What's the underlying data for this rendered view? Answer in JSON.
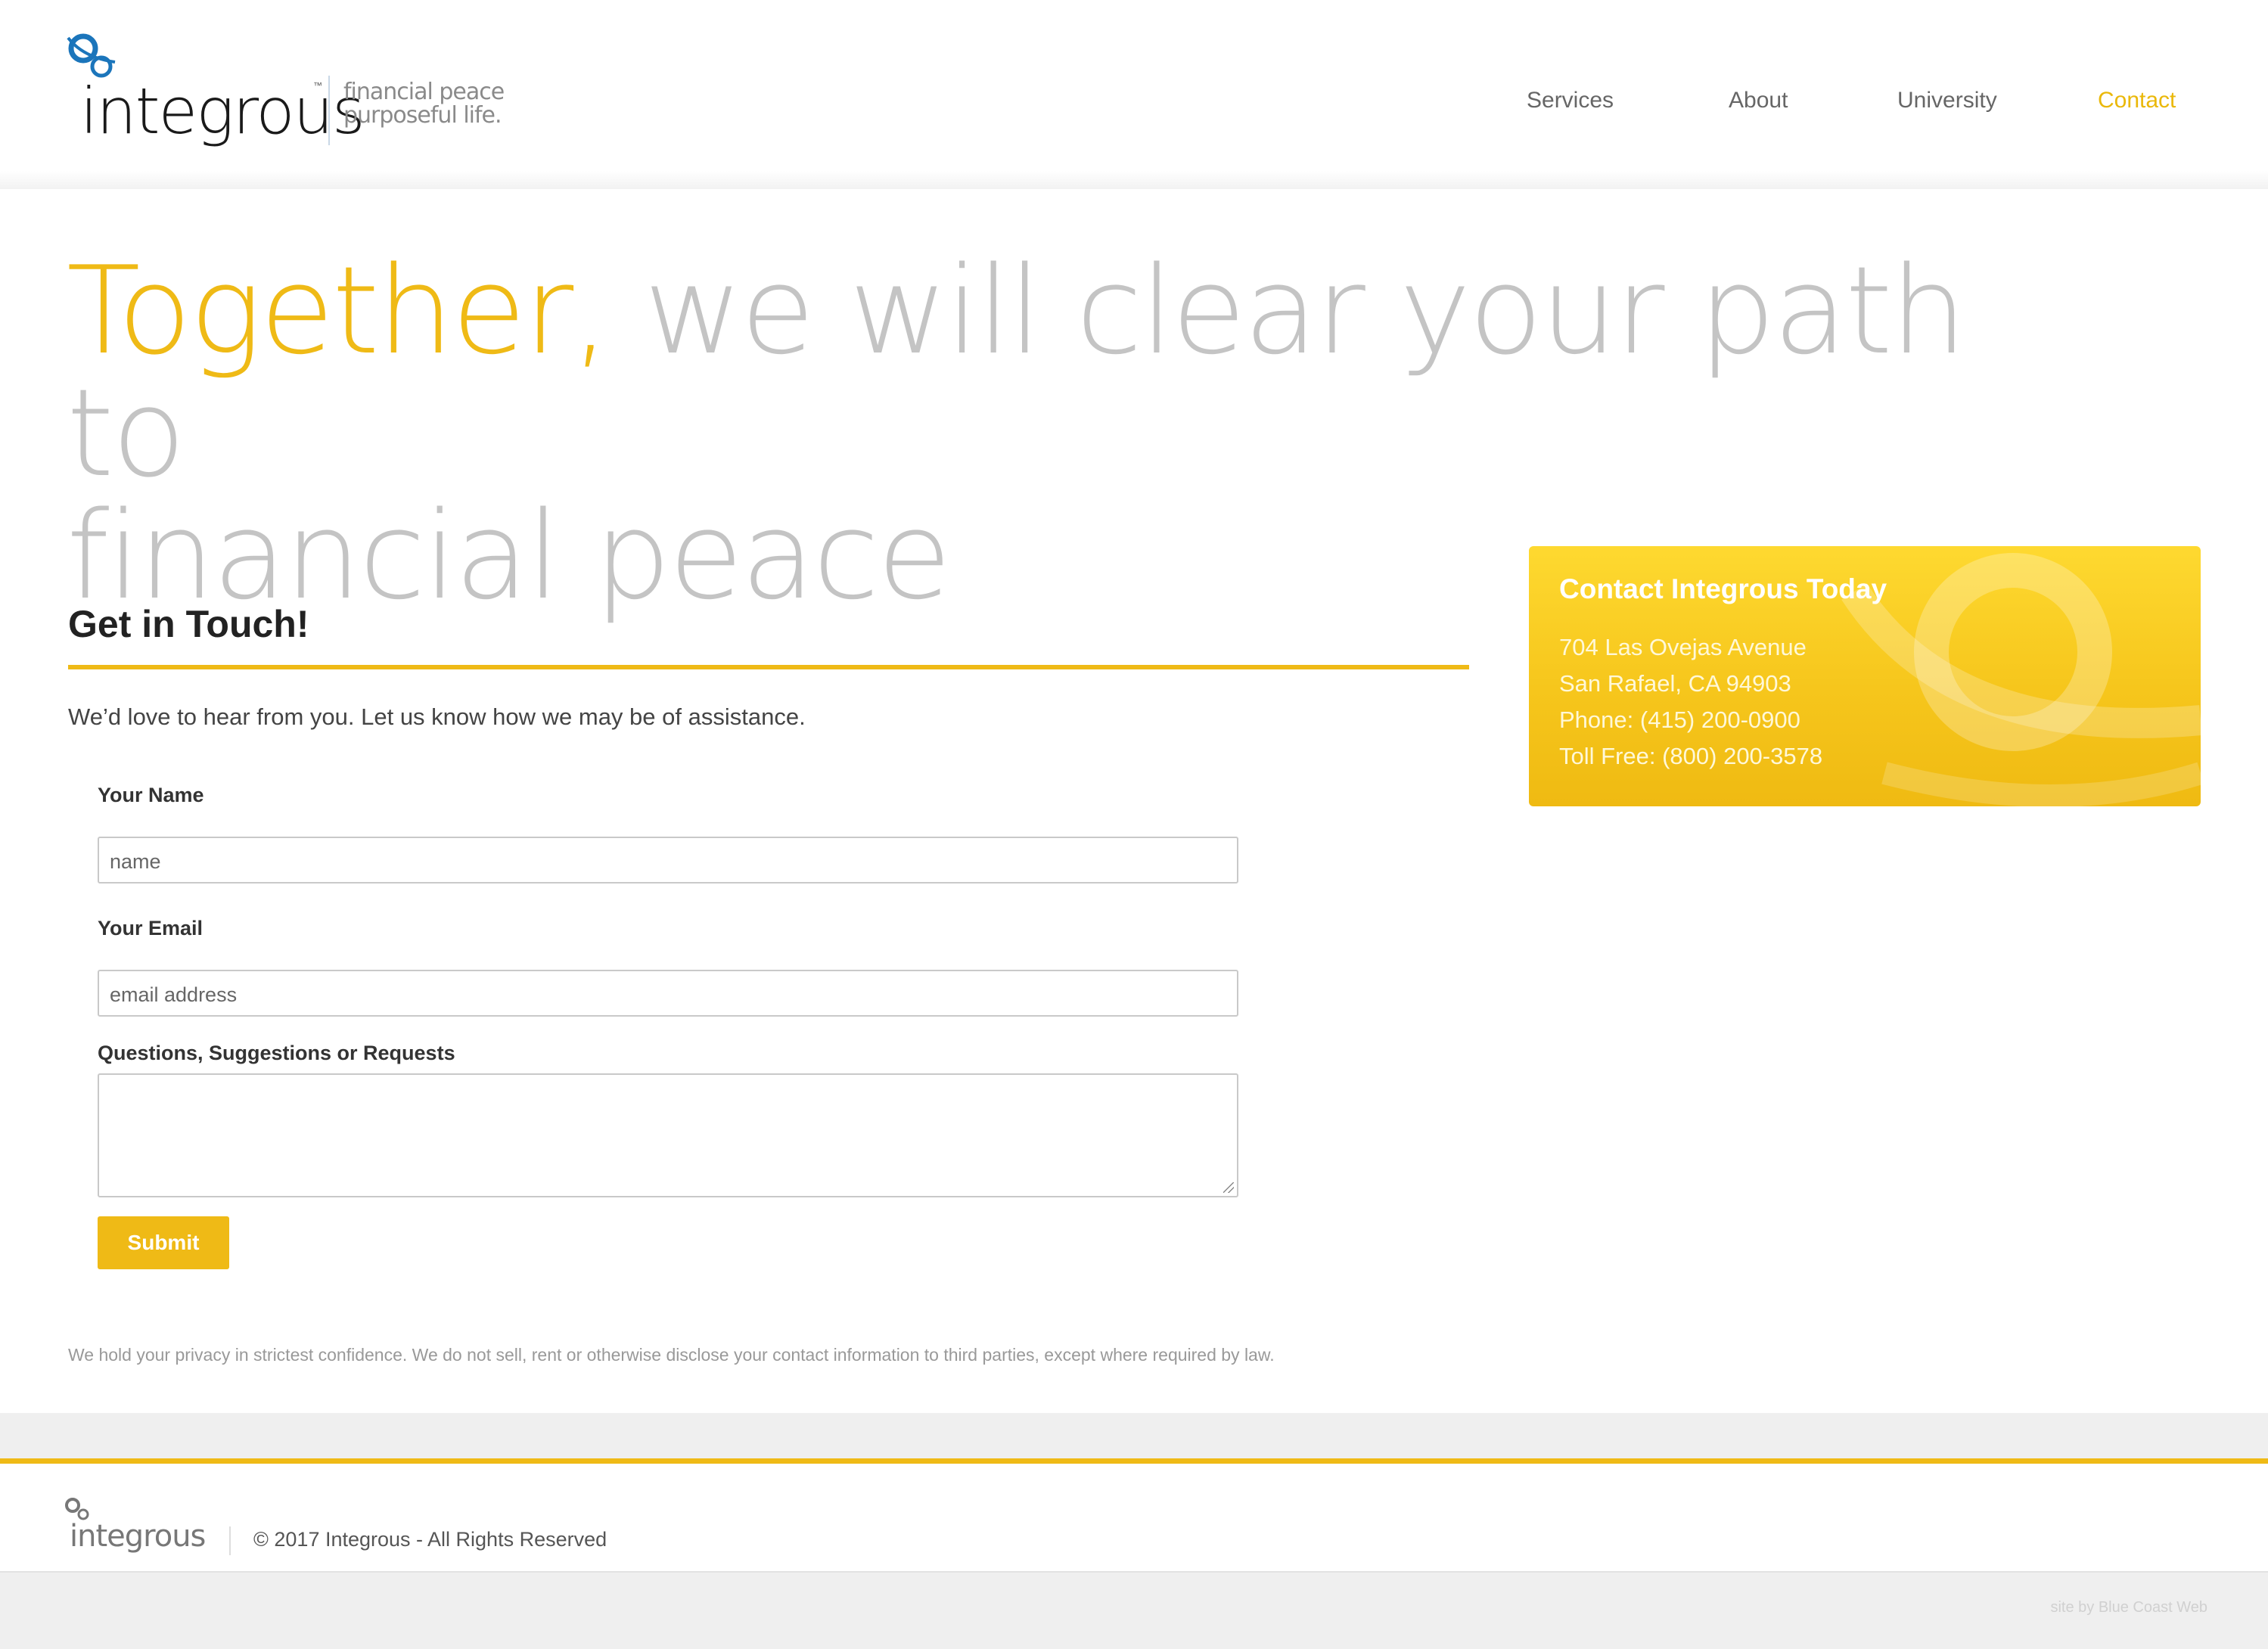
{
  "header": {
    "logo_word": "integrous",
    "logo_tm": "™",
    "tagline_line1": "financial peace",
    "tagline_line2": "purposeful life.",
    "nav": [
      {
        "label": "Services",
        "active": false
      },
      {
        "label": "About",
        "active": false
      },
      {
        "label": "University",
        "active": false
      },
      {
        "label": "Contact",
        "active": true
      }
    ]
  },
  "hero": {
    "accent": "Together,",
    "rest_line1": " we will clear your path to",
    "line2": "financial peace"
  },
  "form": {
    "title": "Get in Touch!",
    "intro": "We’d love to hear from you. Let us know how we may be of assistance.",
    "name_label": "Your Name",
    "name_placeholder": "name",
    "email_label": "Your Email",
    "email_placeholder": "email address",
    "questions_label": "Questions, Suggestions or Requests",
    "questions_value": "",
    "submit_label": "Submit",
    "privacy": "We hold your privacy in strictest confidence. We do not sell, rent or otherwise disclose your contact information to third parties, except where required by law."
  },
  "contact_card": {
    "title": "Contact Integrous Today",
    "address1": "704 Las Ovejas Avenue",
    "address2": "San Rafael, CA 94903",
    "phone": "Phone: (415) 200-0900",
    "tollfree": "Toll Free: (800) 200-3578"
  },
  "footer": {
    "logo_word": "integrous",
    "copyright": "© 2017 Integrous - All Rights Reserved",
    "credit": "site by Blue Coast Web"
  },
  "colors": {
    "accent": "#efba16",
    "logo_blue": "#1b75bb",
    "hero_gray": "#c4c4c4"
  }
}
